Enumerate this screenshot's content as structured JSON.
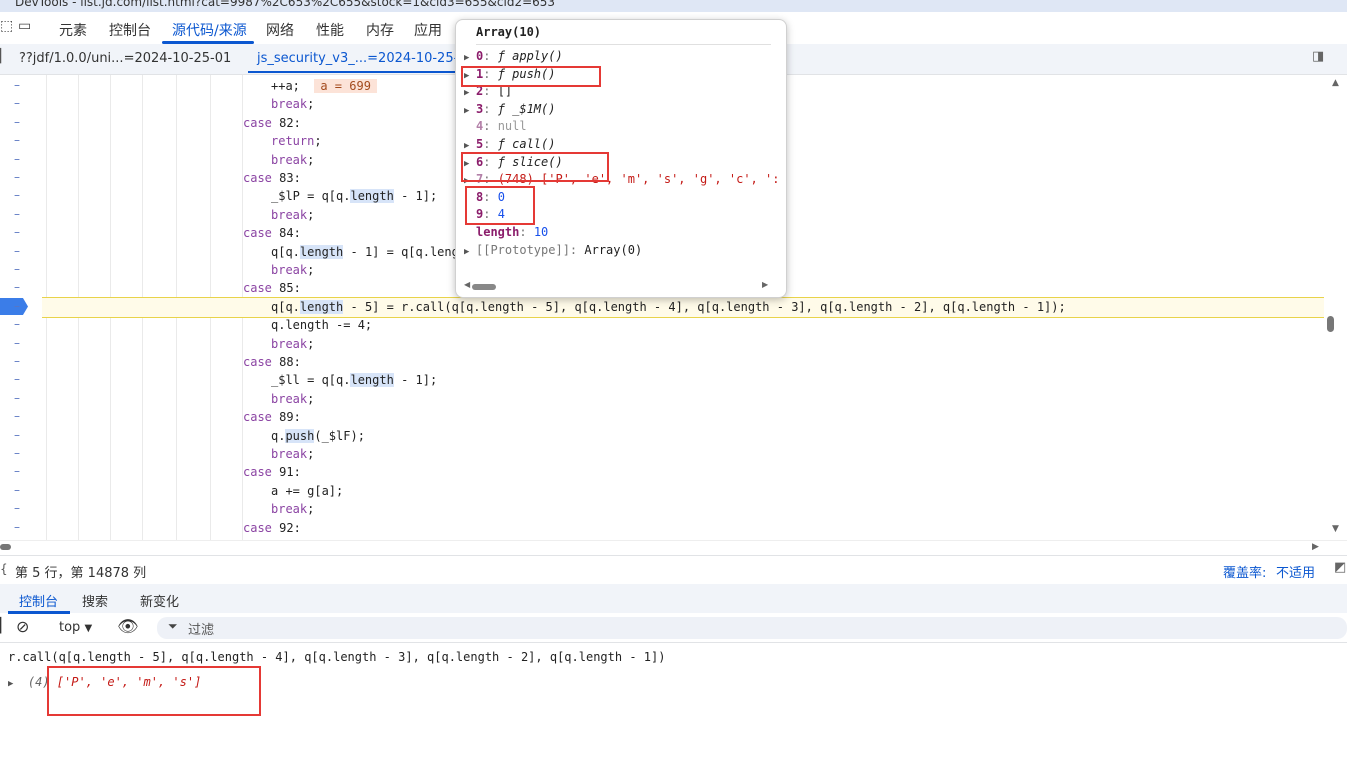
{
  "window": {
    "title": "DevTools - list.jd.com/list.html?cat=9987%2C653%2C655&stock=1&cid3=655&cid2=653"
  },
  "top_tabs": [
    "元素",
    "控制台",
    "源代码/来源",
    "网络",
    "性能",
    "内存",
    "应用"
  ],
  "file_tabs": [
    {
      "label": "??jdf/1.0.0/uni...=2024-10-25-01",
      "active": false
    },
    {
      "label": "js_security_v3_...=2024-10-25-0",
      "active": true
    }
  ],
  "editor": {
    "inline_value": "a = 699",
    "lines": [
      {
        "indent": 2,
        "text": "++a;"
      },
      {
        "indent": 2,
        "kw": "break",
        "rest": ";"
      },
      {
        "indent": 1,
        "kw": "case",
        "rest": " 82:"
      },
      {
        "indent": 2,
        "kw": "return",
        "rest": ";"
      },
      {
        "indent": 2,
        "kw": "break",
        "rest": ";"
      },
      {
        "indent": 1,
        "kw": "case",
        "rest": " 83:"
      },
      {
        "indent": 2,
        "text": "_$lP = q[q.length - 1];"
      },
      {
        "indent": 2,
        "kw": "break",
        "rest": ";"
      },
      {
        "indent": 1,
        "kw": "case",
        "rest": " 84:"
      },
      {
        "indent": 2,
        "text": "q[q.length - 1] = q[q.leng"
      },
      {
        "indent": 2,
        "kw": "break",
        "rest": ";"
      },
      {
        "indent": 1,
        "kw": "case",
        "rest": " 85:"
      },
      {
        "indent": 2,
        "text": "q[q.length - 5] = r.call(q[q.length - 5], q[q.length - 4], q[q.length - 3], q[q.length - 2], q[q.length - 1]);"
      },
      {
        "indent": 2,
        "text": "q.length -= 4;"
      },
      {
        "indent": 2,
        "kw": "break",
        "rest": ";"
      },
      {
        "indent": 1,
        "kw": "case",
        "rest": " 88:"
      },
      {
        "indent": 2,
        "text": "_$ll = q[q.length - 1];"
      },
      {
        "indent": 2,
        "kw": "break",
        "rest": ";"
      },
      {
        "indent": 1,
        "kw": "case",
        "rest": " 89:"
      },
      {
        "indent": 2,
        "text": "q.push(_$lF);"
      },
      {
        "indent": 2,
        "kw": "break",
        "rest": ";"
      },
      {
        "indent": 1,
        "kw": "case",
        "rest": " 91:"
      },
      {
        "indent": 2,
        "text": "a += g[a];"
      },
      {
        "indent": 2,
        "kw": "break",
        "rest": ";"
      },
      {
        "indent": 1,
        "kw": "case",
        "rest": " 92:"
      }
    ]
  },
  "popover": {
    "title": "Array(10)",
    "rows": [
      {
        "key": "0",
        "value": "ƒ apply()",
        "type": "fn",
        "expandable": true
      },
      {
        "key": "1",
        "value": "ƒ push()",
        "type": "fn",
        "expandable": true
      },
      {
        "key": "2",
        "value": "[]",
        "type": "plain",
        "expandable": true
      },
      {
        "key": "3",
        "value": "ƒ _$1M()",
        "type": "fn",
        "expandable": true
      },
      {
        "key": "4",
        "value": "null",
        "type": "null",
        "expandable": false
      },
      {
        "key": "5",
        "value": "ƒ call()",
        "type": "fn",
        "expandable": true
      },
      {
        "key": "6",
        "value": "ƒ slice()",
        "type": "fn",
        "expandable": true
      },
      {
        "key": "7",
        "value": "(748) ['P', 'e', 'm', 's', 'g', 'c', ':",
        "type": "arr",
        "expandable": true
      },
      {
        "key": "8",
        "value": "0",
        "type": "num",
        "expandable": false
      },
      {
        "key": "9",
        "value": "4",
        "type": "num",
        "expandable": false
      },
      {
        "key": "length",
        "value": "10",
        "type": "num",
        "expandable": false
      },
      {
        "key": "[[Prototype]]",
        "value": "Array(0)",
        "type": "proto",
        "expandable": true
      }
    ]
  },
  "status": {
    "position": "第 5 行，第 14878 列",
    "coverage_label": "覆盖率:",
    "coverage_value": "不适用"
  },
  "drawer_tabs": [
    "控制台",
    "搜索",
    "新变化"
  ],
  "console_toolbar": {
    "context": "top",
    "filter_placeholder": "过滤"
  },
  "console": {
    "input": "r.call(q[q.length - 5], q[q.length - 4], q[q.length - 3], q[q.length - 2], q[q.length - 1])",
    "result_len": "(4)",
    "result_value": "['P', 'e', 'm', 's']"
  },
  "colors": {
    "accent": "#0b57d0",
    "annotation": "#e53935",
    "breakpoint": "#3b7de8"
  },
  "icons": {
    "dock": "sidebar-toggle-icon",
    "clear": "clear-console-icon",
    "eye": "live-expression-icon",
    "filter": "filter-icon"
  }
}
